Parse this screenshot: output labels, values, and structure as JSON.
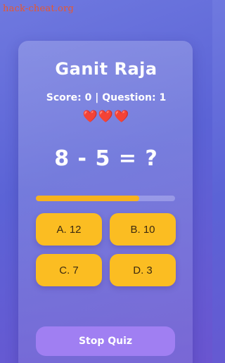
{
  "watermark": "hack-cheat.org",
  "quiz": {
    "title": "Ganit Raja",
    "score_line": "Score: 0 | Question: 1",
    "lives": "❤️❤️❤️",
    "question": "8 - 5 = ?",
    "progress_fraction": 0.74
  },
  "options": [
    {
      "label": "A. 12"
    },
    {
      "label": "B. 10"
    },
    {
      "label": "C. 7"
    },
    {
      "label": "D. 3"
    }
  ],
  "actions": {
    "stop_label": "Stop Quiz"
  },
  "colors": {
    "option_bg": "#fbbd22",
    "stop_bg": "#a07ff2",
    "progress": "#f7b21e"
  }
}
